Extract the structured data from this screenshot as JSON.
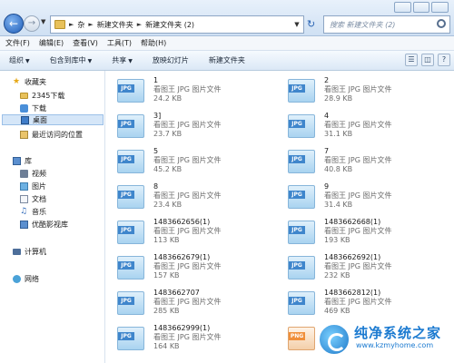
{
  "address": {
    "crumbs": [
      "杂",
      "新建文件夹",
      "新建文件夹 (2)"
    ],
    "search_placeholder": "搜索 新建文件夹 (2)"
  },
  "menu": [
    "文件(F)",
    "编辑(E)",
    "查看(V)",
    "工具(T)",
    "帮助(H)"
  ],
  "toolbar": {
    "organize": "组织",
    "include_library": "包含到库中",
    "share": "共享",
    "slideshow": "放映幻灯片",
    "new_folder": "新建文件夹"
  },
  "sidebar": {
    "favorites": "收藏夹",
    "fav_items": [
      "2345下载",
      "下载",
      "桌面",
      "最近访问的位置"
    ],
    "libraries": "库",
    "lib_items": [
      "视频",
      "图片",
      "文档",
      "音乐",
      "优酷影视库"
    ],
    "computer": "计算机",
    "network": "网络"
  },
  "files": [
    {
      "name": "1",
      "type": "看图王 JPG 图片文件",
      "size": "24.2 KB",
      "ext": "JPG"
    },
    {
      "name": "2",
      "type": "看图王 JPG 图片文件",
      "size": "28.9 KB",
      "ext": "JPG"
    },
    {
      "name": "3]",
      "type": "看图王 JPG 图片文件",
      "size": "23.7 KB",
      "ext": "JPG"
    },
    {
      "name": "4",
      "type": "看图王 JPG 图片文件",
      "size": "31.1 KB",
      "ext": "JPG"
    },
    {
      "name": "5",
      "type": "看图王 JPG 图片文件",
      "size": "45.2 KB",
      "ext": "JPG"
    },
    {
      "name": "7",
      "type": "看图王 JPG 图片文件",
      "size": "40.8 KB",
      "ext": "JPG"
    },
    {
      "name": "8",
      "type": "看图王 JPG 图片文件",
      "size": "23.4 KB",
      "ext": "JPG"
    },
    {
      "name": "9",
      "type": "看图王 JPG 图片文件",
      "size": "31.4 KB",
      "ext": "JPG"
    },
    {
      "name": "1483662656(1)",
      "type": "看图王 JPG 图片文件",
      "size": "113 KB",
      "ext": "JPG"
    },
    {
      "name": "1483662668(1)",
      "type": "看图王 JPG 图片文件",
      "size": "193 KB",
      "ext": "JPG"
    },
    {
      "name": "1483662679(1)",
      "type": "看图王 JPG 图片文件",
      "size": "157 KB",
      "ext": "JPG"
    },
    {
      "name": "1483662692(1)",
      "type": "看图王 JPG 图片文件",
      "size": "232 KB",
      "ext": "JPG"
    },
    {
      "name": "1483662707",
      "type": "看图王 JPG 图片文件",
      "size": "285 KB",
      "ext": "JPG"
    },
    {
      "name": "1483662812(1)",
      "type": "看图王 JPG 图片文件",
      "size": "469 KB",
      "ext": "JPG"
    },
    {
      "name": "1483662999(1)",
      "type": "看图王 JPG 图片文件",
      "size": "164 KB",
      "ext": "JPG"
    },
    {
      "name": "",
      "type": "",
      "size": "",
      "ext": "PNG"
    }
  ],
  "watermark": {
    "title": "纯净系统之家",
    "url": "www.kzmyhome.com"
  },
  "icons": {
    "back": "arrow-left",
    "forward": "arrow-right",
    "refresh": "refresh",
    "search": "magnifier"
  }
}
